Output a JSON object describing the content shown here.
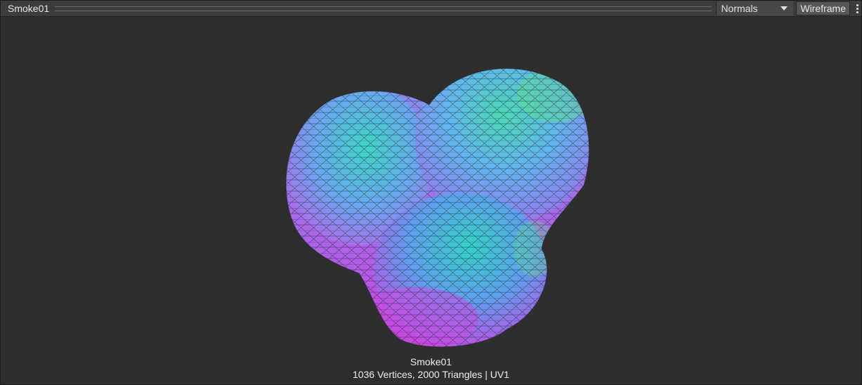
{
  "header": {
    "title": "Smoke01",
    "view_mode": "Normals",
    "wireframe_label": "Wireframe",
    "more_icon": "vertical-ellipsis-icon"
  },
  "viewport": {
    "mesh_name": "Smoke01",
    "mesh_stats": "1036 Vertices, 2000 Triangles | UV1"
  },
  "colors": {
    "background": "#2e2e2e",
    "header": "#3c3c3c",
    "normals_cyan": "#3fd6c8",
    "normals_blue": "#6aa0f0",
    "normals_magenta": "#d14be6",
    "normals_green": "#5fe08a"
  }
}
